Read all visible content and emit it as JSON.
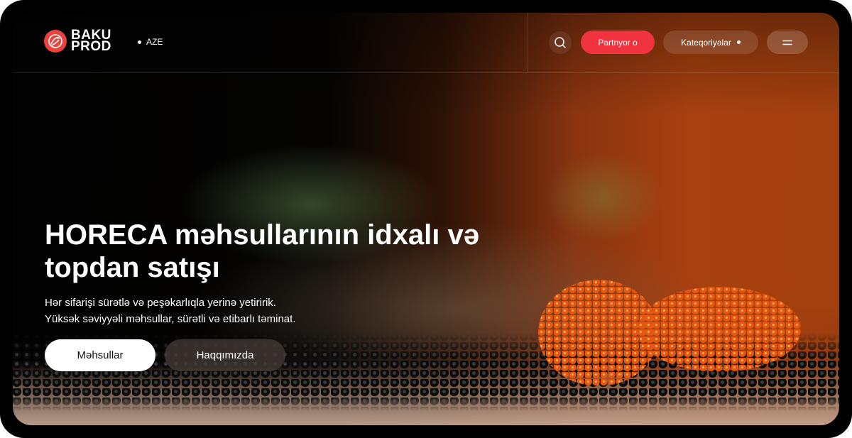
{
  "header": {
    "logo_line1": "BAKU",
    "logo_line2": "PROD",
    "language": "AZE",
    "partner_label": "Partnyor o",
    "categories_label": "Kateqoriyalar"
  },
  "hero": {
    "title": "HORECA məhsullarının idxalı və topdan satışı",
    "subtitle_line1": "Hər sifarişi sürətlə və peşəkarlıqla yerinə yetiririk.",
    "subtitle_line2": "Yüksək səviyyəli məhsullar, sürətli və etibarlı təminat.",
    "primary_button": "Məhsullar",
    "secondary_button": "Haqqımızda"
  },
  "colors": {
    "accent": "#f0333f",
    "logo_red": "#e8433f",
    "hero_orange": "#a8400f"
  },
  "icons": {
    "logo": "baku-prod-logo-icon",
    "search": "search-icon",
    "menu": "hamburger-menu-icon"
  }
}
